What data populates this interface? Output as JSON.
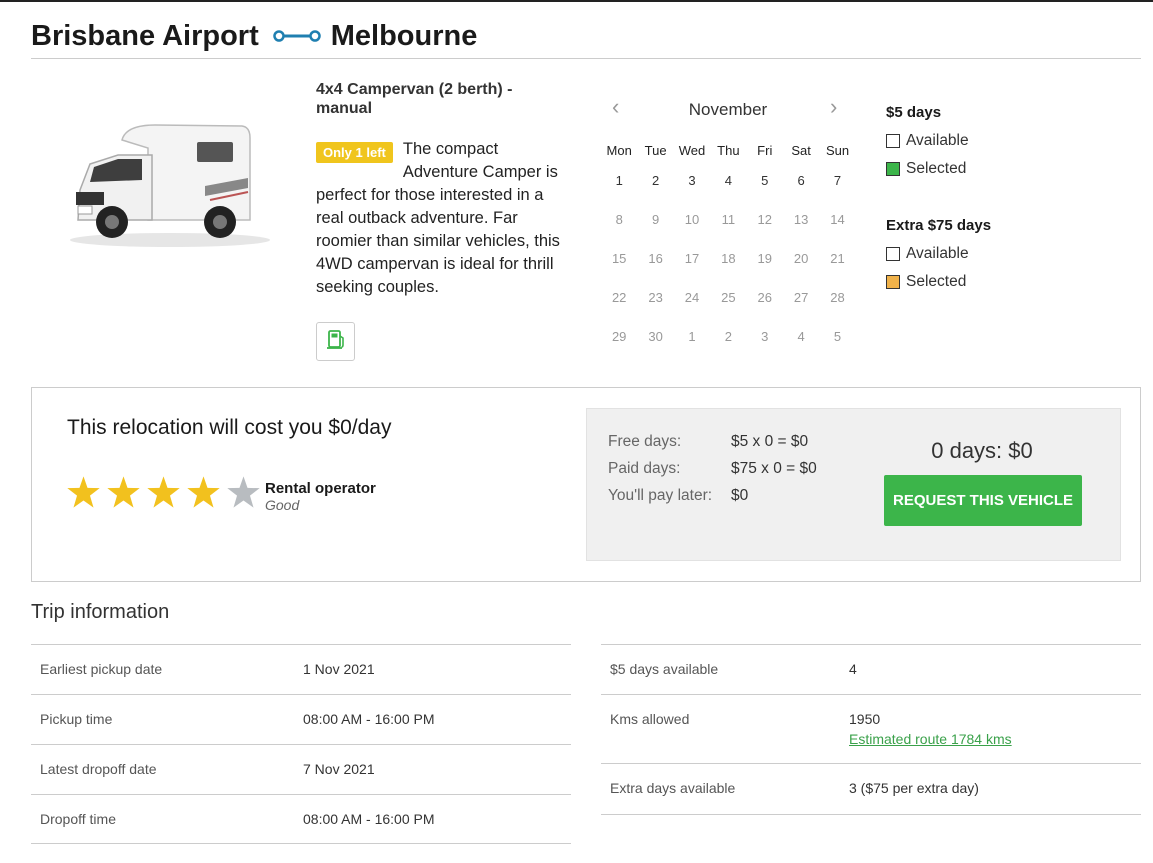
{
  "header": {
    "from": "Brisbane Airport",
    "to": "Melbourne",
    "route_icon": "route-arrow-icon"
  },
  "vehicle": {
    "title": "4x4 Campervan (2 berth) - manual",
    "badge": "Only 1 left",
    "description": "The compact Adventure Camper is perfect for those interested in a real outback adventure. Far roomier than similar vehicles, this 4WD campervan is ideal for thrill seeking couples.",
    "fuel_icon": "fuel-icon",
    "image": "campervan-image"
  },
  "calendar": {
    "month": "November",
    "weekdays": [
      "Mon",
      "Tue",
      "Wed",
      "Thu",
      "Fri",
      "Sat",
      "Sun"
    ],
    "weeks": [
      [
        "1",
        "2",
        "3",
        "4",
        "5",
        "6",
        "7"
      ],
      [
        "8",
        "9",
        "10",
        "11",
        "12",
        "13",
        "14"
      ],
      [
        "15",
        "16",
        "17",
        "18",
        "19",
        "20",
        "21"
      ],
      [
        "22",
        "23",
        "24",
        "25",
        "26",
        "27",
        "28"
      ],
      [
        "29",
        "30",
        "1",
        "2",
        "3",
        "4",
        "5"
      ]
    ]
  },
  "legend": {
    "five_days": {
      "title": "$5 days",
      "available": "Available",
      "selected": "Selected",
      "selected_color": "#3cb54a"
    },
    "extra_days": {
      "title": "Extra $75 days",
      "available": "Available",
      "selected": "Selected",
      "selected_color": "#f0b24a"
    }
  },
  "cost": {
    "title": "This relocation will cost you $0/day",
    "rating": 4,
    "rating_max": 5,
    "star_color": "#f2c11e",
    "star_empty_color": "#b8bcc0",
    "operator_label": "Rental operator",
    "operator_rating": "Good",
    "free_days_label": "Free days:",
    "free_days_value": "$5 x 0 = $0",
    "paid_days_label": "Paid days:",
    "paid_days_value": "$75 x 0 = $0",
    "pay_later_label": "You'll pay later:",
    "pay_later_value": "$0",
    "total": "0 days: $0",
    "request_button": "REQUEST THIS VEHICLE",
    "button_color": "#3cb54a"
  },
  "trip": {
    "title": "Trip information",
    "left": [
      {
        "label": "Earliest pickup date",
        "value": "1 Nov 2021"
      },
      {
        "label": "Pickup time",
        "value": "08:00 AM - 16:00 PM"
      },
      {
        "label": "Latest dropoff date",
        "value": "7 Nov 2021"
      },
      {
        "label": "Dropoff time",
        "value": "08:00 AM - 16:00 PM"
      }
    ],
    "right": [
      {
        "label": "$5 days available",
        "value": "4"
      },
      {
        "label": "Kms allowed",
        "value": "1950",
        "link": "Estimated route 1784 kms"
      },
      {
        "label": "Extra days available",
        "value": "3 ($75 per extra day)"
      }
    ]
  }
}
